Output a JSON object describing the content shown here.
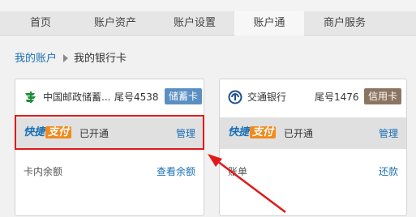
{
  "nav": {
    "tabs": [
      {
        "label": "首页"
      },
      {
        "label": "账户资产"
      },
      {
        "label": "账户设置"
      },
      {
        "label": "账户通",
        "active": true
      },
      {
        "label": "商户服务"
      }
    ]
  },
  "breadcrumb": {
    "parent": "我的账户",
    "current": "我的银行卡"
  },
  "cards": [
    {
      "bank_name": "中国邮政储蓄...",
      "tail": "尾号4538",
      "type": "储蓄卡",
      "type_color": "#5b8fc2",
      "pay_brand_a": "快捷",
      "pay_brand_b": "支付",
      "status": "已开通",
      "manage": "管理",
      "bottom_label": "卡内余额",
      "bottom_link": "查看余额",
      "logo_icon": "postal-savings-logo-icon"
    },
    {
      "bank_name": "交通银行",
      "tail": "尾号1476",
      "type": "信用卡",
      "type_color": "#8c7560",
      "pay_brand_a": "快捷",
      "pay_brand_b": "支付",
      "status": "已开通",
      "manage": "管理",
      "bottom_label": "账单",
      "bottom_link": "还款",
      "logo_icon": "bocom-logo-icon"
    }
  ],
  "colors": {
    "link": "#1a6fb5",
    "highlight": "#e0191b",
    "brand_orange": "#f08a1c"
  }
}
